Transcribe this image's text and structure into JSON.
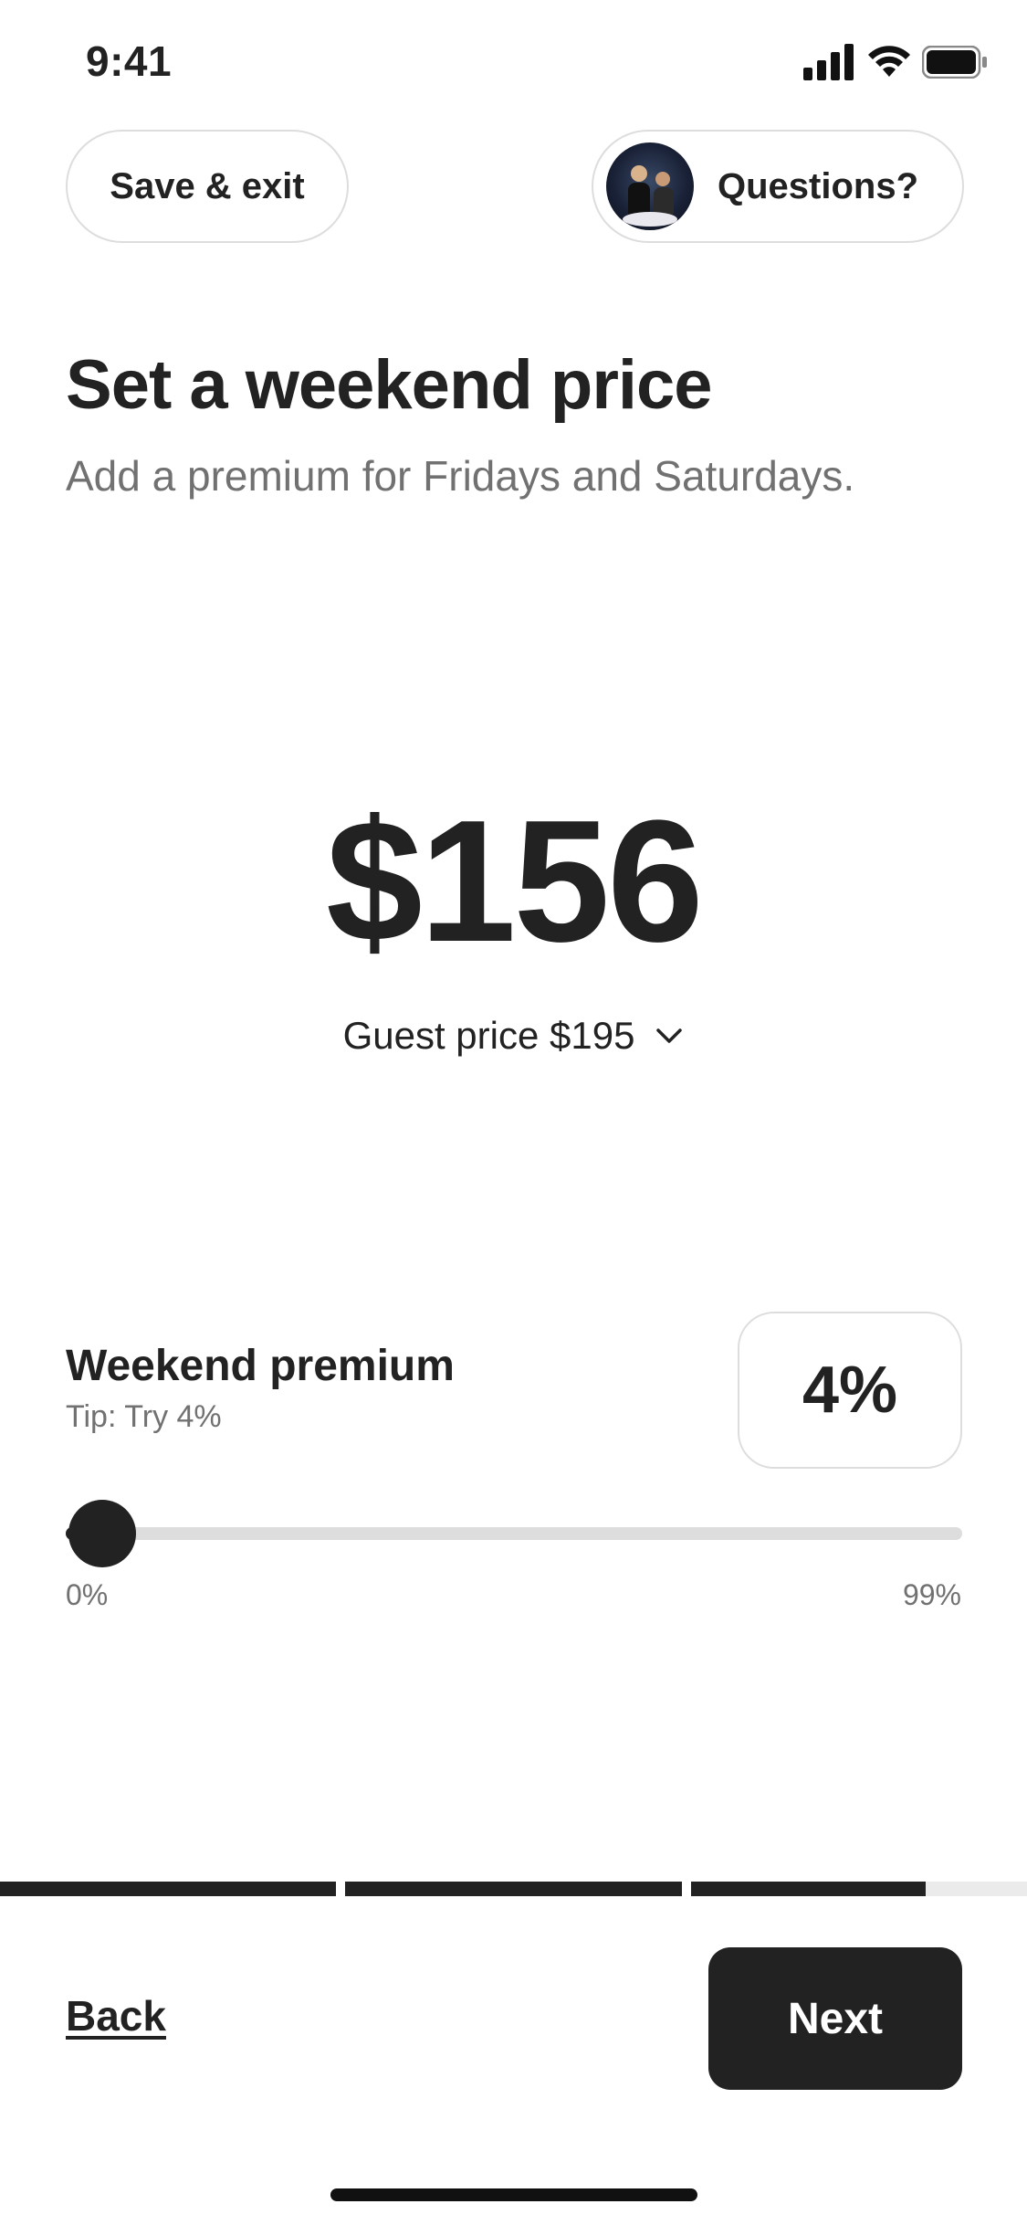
{
  "status_bar": {
    "time": "9:41"
  },
  "header": {
    "save_exit_label": "Save & exit",
    "questions_label": "Questions?"
  },
  "main": {
    "title": "Set a weekend price",
    "subtitle": "Add a premium for Fridays and Saturdays.",
    "price": "$156",
    "guest_price_label": "Guest price $195"
  },
  "premium": {
    "label": "Weekend premium",
    "tip": "Tip: Try 4%",
    "value_display": "4%",
    "slider": {
      "value": 4,
      "min": 0,
      "max": 99,
      "min_label": "0%",
      "max_label": "99%"
    }
  },
  "progress": {
    "segments": [
      1,
      1,
      0.7
    ]
  },
  "footer": {
    "back_label": "Back",
    "next_label": "Next"
  },
  "colors": {
    "text": "#222222",
    "muted": "#717171",
    "border": "#dddddd",
    "accent": "#222222"
  }
}
